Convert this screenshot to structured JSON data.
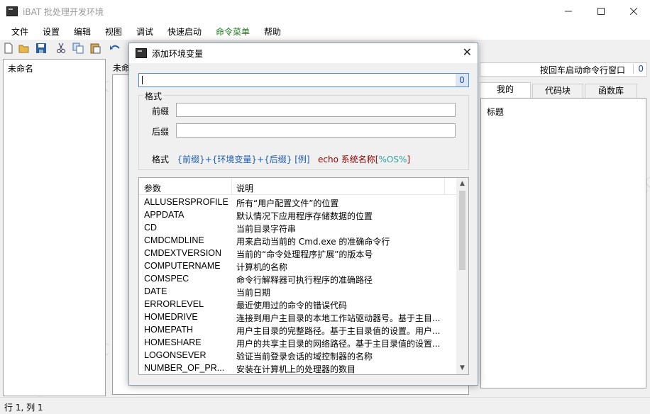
{
  "window": {
    "title": "iBAT 批处理开发环境",
    "icon": "terminal-icon"
  },
  "menu": [
    "文件",
    "设置",
    "编辑",
    "视图",
    "调试",
    "快速启动",
    "命令菜单",
    "帮助"
  ],
  "menu_highlight_color": "#1e7b1e",
  "left_pane": {
    "item": "未命名"
  },
  "center": {
    "tab_label": "未命"
  },
  "right_pane": {
    "run_label": "按回车启动命令行窗口",
    "run_count": "0",
    "tabs": [
      "我的",
      "代码块",
      "函数库"
    ],
    "header": "标题"
  },
  "status": {
    "text": "行 1, 列 1"
  },
  "watermark": "WWW.WEIDOWN.COM",
  "dialog": {
    "title": "添加环境变量",
    "close": "✕",
    "search_count": "0",
    "format": {
      "legend": "格式",
      "prefix_label": "前缀",
      "suffix_label": "后缀",
      "line_label": "格式",
      "line_pattern": "{前缀}+{环境变量}+{后缀}",
      "line_example_label": "[例]",
      "line_example_cmd": "echo 系统名称[",
      "line_example_var": "%OS%",
      "line_example_end": "]"
    },
    "list": {
      "col_param": "参数",
      "col_desc": "说明",
      "rows": [
        {
          "param": "ALLUSERSPROFILE",
          "desc": "所有“用户配置文件”的位置"
        },
        {
          "param": "APPDATA",
          "desc": "默认情况下应用程序存储数据的位置"
        },
        {
          "param": "CD",
          "desc": "当前目录字符串"
        },
        {
          "param": "CMDCMDLINE",
          "desc": "用来启动当前的 Cmd.exe 的准确命令行"
        },
        {
          "param": "CMDEXTVERSION",
          "desc": "当前的“命令处理程序扩展”的版本号"
        },
        {
          "param": "COMPUTERNAME",
          "desc": "计算机的名称"
        },
        {
          "param": "COMSPEC",
          "desc": "命令行解释器可执行程序的准确路径"
        },
        {
          "param": "DATE",
          "desc": "当前日期"
        },
        {
          "param": "ERRORLEVEL",
          "desc": "最近使用过的命令的错误代码"
        },
        {
          "param": "HOMEDRIVE",
          "desc": "连接到用户主目录的本地工作站驱动器号。基于主目..."
        },
        {
          "param": "HOMEPATH",
          "desc": "用户主目录的完整路径。基于主目录值的设置。用户..."
        },
        {
          "param": "HOMESHARE",
          "desc": "用户的共享主目录的网络路径。基于主目录值的设置..."
        },
        {
          "param": "LOGONSEVER",
          "desc": "验证当前登录会话的域控制器的名称"
        },
        {
          "param": "NUMBER_OF_PR...",
          "desc": "安装在计算机上的处理器的数目"
        }
      ]
    }
  }
}
